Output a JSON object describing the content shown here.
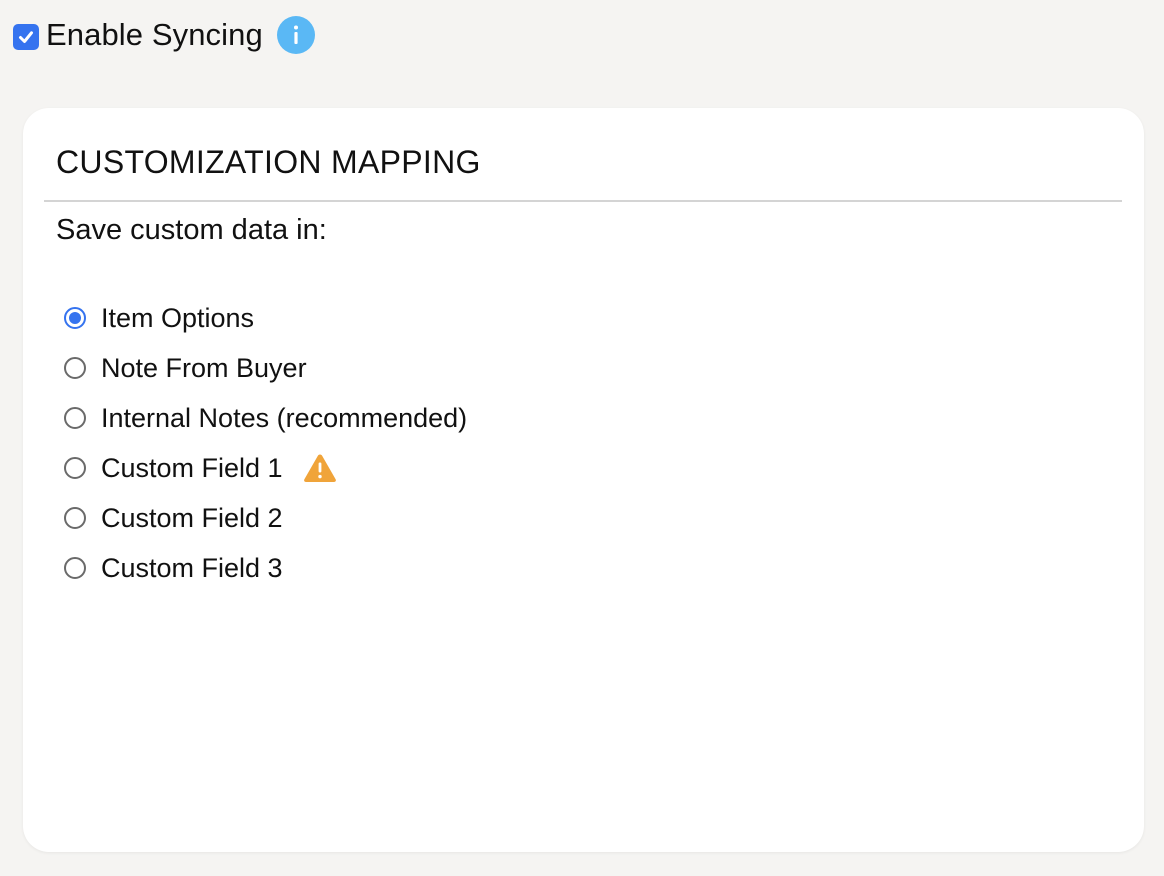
{
  "sync": {
    "label": "Enable Syncing",
    "checked": true,
    "info_icon": "info-icon"
  },
  "panel": {
    "title": "CUSTOMIZATION MAPPING",
    "save_label": "Save custom data in:",
    "options": [
      {
        "label": "Item Options",
        "selected": true
      },
      {
        "label": "Note From Buyer",
        "selected": false
      },
      {
        "label": "Internal Notes (recommended)",
        "selected": false
      },
      {
        "label": "Custom Field 1",
        "selected": false,
        "icon": "warning-icon"
      },
      {
        "label": "Custom Field 2",
        "selected": false
      },
      {
        "label": "Custom Field 3",
        "selected": false
      }
    ]
  },
  "colors": {
    "accent": "#3573ef",
    "info": "#5ab8f5",
    "warning": "#f0a43a",
    "background": "#f5f4f2",
    "panel": "#ffffff"
  }
}
